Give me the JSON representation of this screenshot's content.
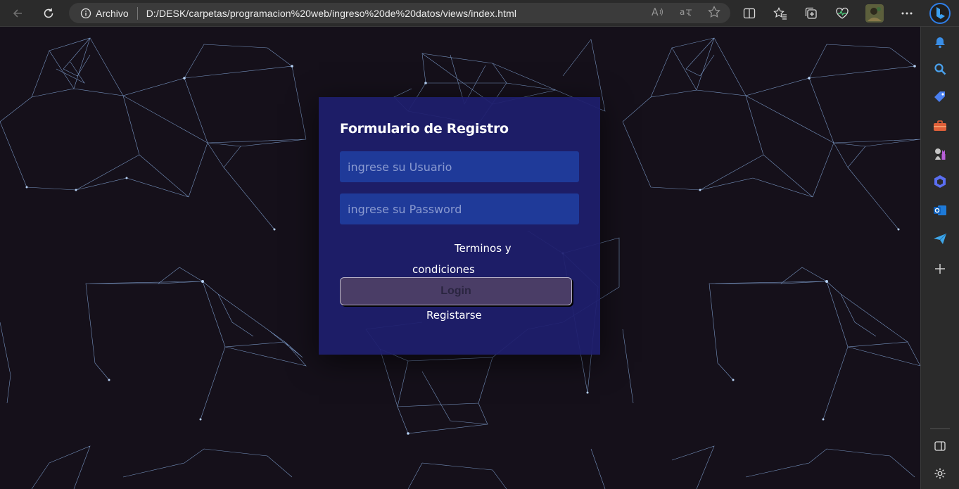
{
  "browser": {
    "site_info_label": "Archivo",
    "url": "D:/DESK/carpetas/programacion%20web/ingreso%20de%20datos/views/index.html",
    "read_aloud_label": "A⁾",
    "translate_label": "aआ"
  },
  "form": {
    "title": "Formulario de Registro",
    "user_placeholder": "ingrese su Usuario",
    "password_placeholder": "ingrese su Password",
    "terms_line1": "Terminos y",
    "terms_line2": "condiciones",
    "login_label": "Login",
    "register_label": "Registarse"
  },
  "colors": {
    "page_background": "#15101a",
    "card_background": "#1e1e6e",
    "input_background": "#1f3a99",
    "button_background": "#4a3d66",
    "network_lines": "#8fb4e8",
    "browser_chrome": "#2b2b2b"
  }
}
